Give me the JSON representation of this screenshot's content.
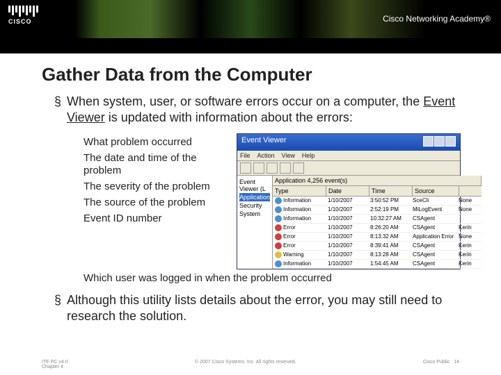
{
  "header": {
    "logo_text": "CISCO",
    "academy": "Cisco Networking Academy®"
  },
  "title": "Gather Data from the Computer",
  "bullets": [
    "When system, user, or software errors occur on a computer, the ",
    " is updated with information about the errors:",
    "Although this utility lists details about the error, you may still need to research the solution."
  ],
  "evlink": "Event Viewer",
  "subs": [
    "What problem occurred",
    "The date and time of the problem",
    "The severity of the problem",
    "The source of the problem",
    "Event ID number",
    "Which user was logged in when the problem occurred"
  ],
  "ev": {
    "title": "Event Viewer",
    "menu": [
      "File",
      "Action",
      "View",
      "Help"
    ],
    "tree_root": "Event Viewer (L",
    "tree": [
      "Application",
      "Security",
      "System"
    ],
    "list_header": "Application   4,256 event(s)",
    "cols": [
      "Type",
      "Date",
      "Time",
      "Source"
    ],
    "rows": [
      {
        "t": "Information",
        "d": "1/10/2007",
        "tm": "3:50:52 PM",
        "s": "SceCli",
        "ic": "i",
        "u": "None"
      },
      {
        "t": "Information",
        "d": "1/10/2007",
        "tm": "2:52:19 PM",
        "s": "MiLogEvent",
        "ic": "i",
        "u": "None"
      },
      {
        "t": "Information",
        "d": "1/10/2007",
        "tm": "10:32:27 AM",
        "s": "CSAgent",
        "ic": "i",
        "u": ""
      },
      {
        "t": "Error",
        "d": "1/10/2007",
        "tm": "8:26:20 AM",
        "s": "CSAgent",
        "ic": "e",
        "u": "Kerin"
      },
      {
        "t": "Error",
        "d": "1/10/2007",
        "tm": "8:13:32 AM",
        "s": "Application Error",
        "ic": "e",
        "u": "None"
      },
      {
        "t": "Error",
        "d": "1/10/2007",
        "tm": "8:39:41 AM",
        "s": "CSAgent",
        "ic": "e",
        "u": "Kerin"
      },
      {
        "t": "Warning",
        "d": "1/10/2007",
        "tm": "8:13:28 AM",
        "s": "CSAgent",
        "ic": "w",
        "u": "Kerin"
      },
      {
        "t": "Information",
        "d": "1/10/2007",
        "tm": "1:54:45 AM",
        "s": "CSAgent",
        "ic": "i",
        "u": "Kerin"
      }
    ]
  },
  "footer": {
    "l1": "ITE PC v4.0",
    "l2": "Chapter 4",
    "c": "© 2007 Cisco Systems, Inc. All rights reserved.",
    "r": "Cisco Public",
    "pn": "14"
  }
}
